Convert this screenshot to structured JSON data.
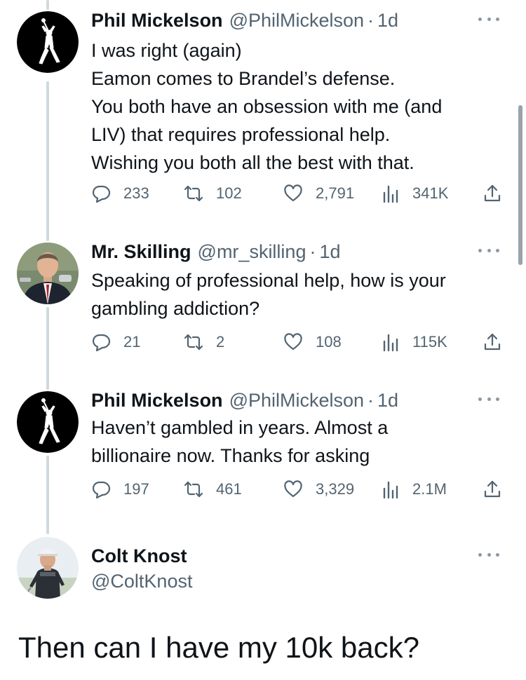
{
  "tweets": [
    {
      "name": "Phil Mickelson",
      "handle": "@PhilMickelson",
      "separator": "·",
      "time": "1d",
      "lines": [
        "I was right (again)",
        "Eamon comes to Brandel’s defense.",
        "You both have an obsession with me (and",
        "LIV) that requires professional help.",
        "Wishing you both all the best with that."
      ],
      "replies": "233",
      "retweets": "102",
      "likes": "2,791",
      "views": "341K"
    },
    {
      "name": "Mr. Skilling",
      "handle": "@mr_skilling",
      "separator": "·",
      "time": "1d",
      "lines": [
        "Speaking of professional help, how is your",
        "gambling addiction?"
      ],
      "replies": "21",
      "retweets": "2",
      "likes": "108",
      "views": "115K"
    },
    {
      "name": "Phil Mickelson",
      "handle": "@PhilMickelson",
      "separator": "·",
      "time": "1d",
      "lines": [
        "Haven’t gambled in years. Almost a",
        "billionaire now. Thanks for asking"
      ],
      "replies": "197",
      "retweets": "461",
      "likes": "3,329",
      "views": "2.1M"
    }
  ],
  "profile_card": {
    "name": "Colt Knost",
    "handle": "@ColtKnost"
  },
  "caption": "Then can I have my 10k back?",
  "icons": {
    "reply": "speech-bubble-icon",
    "retweet": "retweet-arrows-icon",
    "like": "heart-outline-icon",
    "views": "bar-chart-icon",
    "share": "share-upload-icon",
    "more": "three-dots-icon"
  },
  "colors": {
    "text": "#0f1419",
    "secondary": "#536471",
    "thread_line": "#cfd9de",
    "more_dots": "#8b98a5"
  }
}
